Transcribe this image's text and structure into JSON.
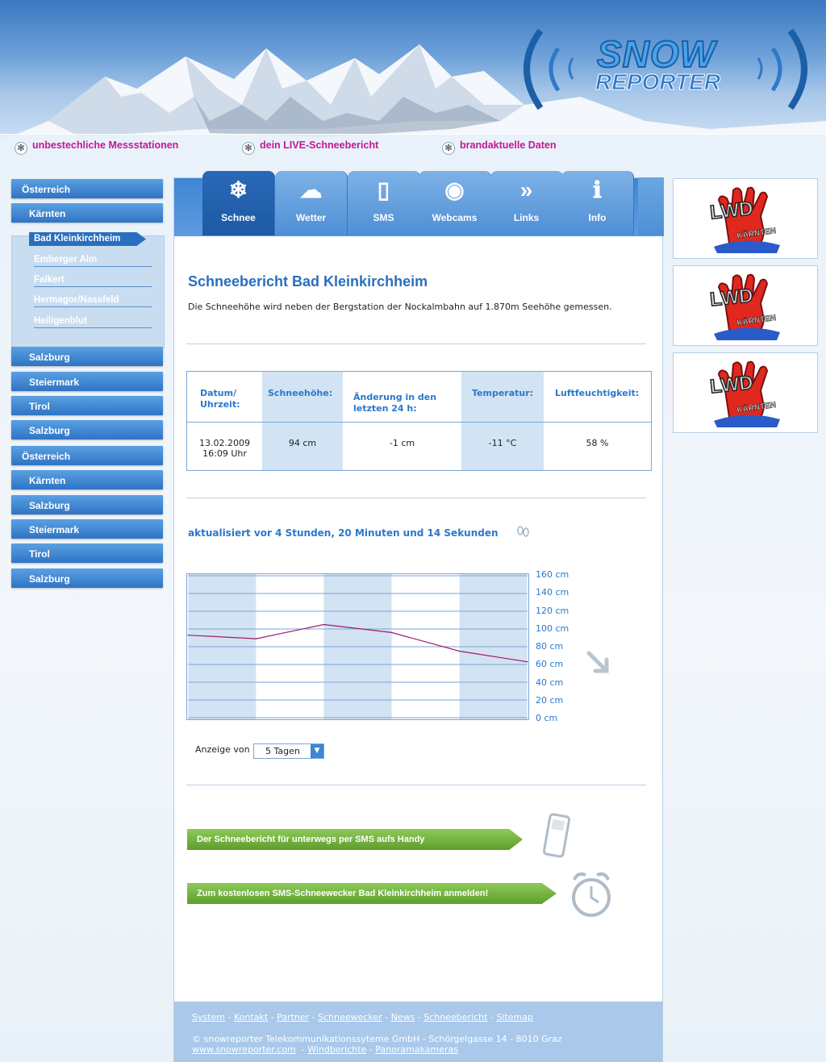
{
  "header": {
    "logo_top": "SNOW",
    "logo_bottom": "REPORTER",
    "taglines": [
      "unbestechliche Messstationen",
      "dein LIVE-Schneebericht",
      "brandaktuelle Daten"
    ]
  },
  "leftnav": {
    "items": [
      {
        "label": "Österreich",
        "level": 0
      },
      {
        "label": "Kärnten",
        "level": 1
      }
    ],
    "subitems": [
      "Bad Kleinkirchheim",
      "Emberger Alm",
      "Falkert",
      "Hermagor/Nassfeld",
      "Heiligenblut"
    ],
    "active_subitem": "Bad Kleinkirchheim",
    "more": [
      {
        "label": "Salzburg",
        "level": 1
      },
      {
        "label": "Steiermark",
        "level": 1
      },
      {
        "label": "Tirol",
        "level": 1
      },
      {
        "label": "Salzburg",
        "level": 1
      },
      {
        "label": "Österreich",
        "level": 0
      },
      {
        "label": "Kärnten",
        "level": 1
      },
      {
        "label": "Salzburg",
        "level": 1
      },
      {
        "label": "Steiermark",
        "level": 1
      },
      {
        "label": "Tirol",
        "level": 1
      },
      {
        "label": "Salzburg",
        "level": 1
      }
    ]
  },
  "tabs": [
    {
      "label": "Schnee",
      "icon": "snowflake-icon",
      "active": true
    },
    {
      "label": "Wetter",
      "icon": "weather-icon"
    },
    {
      "label": "SMS",
      "icon": "mobile-phone-icon"
    },
    {
      "label": "Webcams",
      "icon": "webcam-icon"
    },
    {
      "label": "Links",
      "icon": "arrows-icon"
    },
    {
      "label": "Info",
      "icon": "info-icon"
    }
  ],
  "main": {
    "title": "Schneebericht Bad Kleinkirchheim",
    "intro": "Die Schneehöhe wird neben der Bergstation der Nockalmbahn auf 1.870m Seehöhe gemessen.",
    "table": {
      "headers": [
        "Datum/ Uhrzeit:",
        "Schneehöhe:",
        "Änderung in den letzten 24 h:",
        "Temperatur:",
        "Luftfeuchtigkeit:"
      ],
      "date": "13.02.2009",
      "time": "16:09 Uhr",
      "snow": "94 cm",
      "change": "-1 cm",
      "temp": "-11 °C",
      "humidity": "58 %"
    },
    "updated": "aktualisiert vor 4 Stunden, 20 Minuten und 14 Sekunden",
    "select_label": "Anzeige von",
    "select_value": "5 Tagen",
    "sms_button": "Der Schneebericht für unterwegs per SMS aufs Handy",
    "wecker_button": "Zum kostenlosen SMS-Schneewecker Bad Kleinkirchheim anmelden!"
  },
  "chart_data": {
    "type": "line",
    "y_ticks": [
      "160 cm",
      "140 cm",
      "120 cm",
      "100 cm",
      "80 cm",
      "60 cm",
      "40 cm",
      "20 cm",
      "0 cm"
    ],
    "ylim": [
      0,
      160
    ],
    "series": [
      {
        "values": [
          93,
          89,
          105,
          96,
          75,
          63
        ],
        "color": "#a3186f"
      }
    ]
  },
  "footer": {
    "links": [
      "System",
      "Kontakt",
      "Partner",
      "Schneewecker",
      "News",
      "Schneebericht",
      "Sitemap"
    ],
    "copyright": "© snowreporter Telekommunikationssyteme GmbH - Schörgelgasse 14 - 8010 Graz",
    "bottom_links": [
      "www.snowreporter.com",
      "Windberichte",
      "Panoramakameras"
    ]
  },
  "ads": {
    "label": "LWD KÄRNTEN",
    "count": 3
  },
  "colors": {
    "accent": "#2a78cc",
    "tagline": "#c2188f",
    "chart_line": "#a3186f",
    "button_green": "#6aaa36"
  }
}
